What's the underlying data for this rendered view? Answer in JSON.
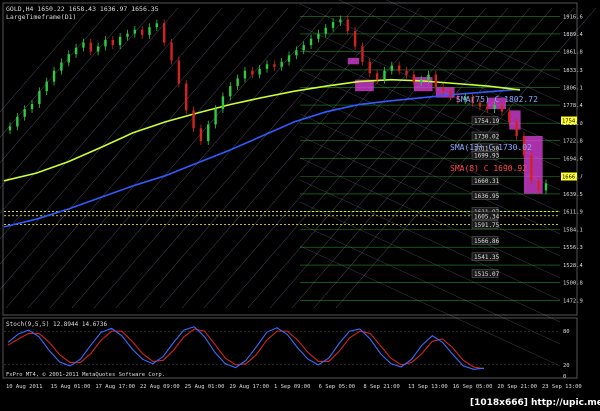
{
  "header": {
    "symbol_line": "GOLD,H4  1650.22  1658.43  1636.97  1656.35",
    "subtitle": "LargeTimeframe(D1)"
  },
  "footer": {
    "copyright": "FxPro MT4, © 2001-2011 MetaQuotes Software Corp.",
    "watermark": "[1018x666] http://upic.me/"
  },
  "colors": {
    "background": "#000000",
    "bull": "#2ecc40",
    "bear": "#d22222",
    "sma_yellow": "#ccff33",
    "sma_blue": "#2f5bff",
    "box_magenta": "#e040e0",
    "gann_lines": "#9aa0c8",
    "level_green": "#2ea82e",
    "level_yellow": "#ffff33",
    "label_box_bg": "#1a1a1a"
  },
  "annotations": {
    "sma75": "SMA(75) C 1802.72",
    "sma13": "SMA(13) C 1730.02",
    "sma_red": "SMA(8) C 1690.92"
  },
  "level_labels": [
    "1754.19",
    "1730.02",
    "1711.50",
    "1699.93",
    "1660.31",
    "1636.95",
    "1611.97",
    "1605.34",
    "1591.75",
    "1566.86",
    "1541.35",
    "1515.07"
  ],
  "oscillator": {
    "label": "Stoch(9,5,5) 12.8944 14.6736",
    "ticks": [
      "80",
      "20",
      "0"
    ]
  },
  "chart_data": {
    "type": "candlestick",
    "title": "GOLD,H4",
    "ylim": [
      1455,
      1930
    ],
    "y_ticks": [
      1916.6,
      1889.4,
      1861.8,
      1833.3,
      1806.1,
      1778.4,
      1750.0,
      1722.8,
      1694.6,
      1666.7,
      1639.5,
      1611.9,
      1584.1,
      1556.3,
      1528.4,
      1500.8,
      1472.9
    ],
    "x_ticks": [
      "10 Aug 2011",
      "15 Aug 01:00",
      "17 Aug 17:00",
      "22 Aug 09:00",
      "25 Aug 01:00",
      "29 Aug 17:00",
      "1 Sep 09:00",
      "6 Sep 05:00",
      "8 Sep 21:00",
      "13 Sep 13:00",
      "16 Sep 05:00",
      "20 Sep 21:00",
      "23 Sep 13:00"
    ],
    "last_price": 1656.35,
    "price_markers": [
      1754.19,
      1666.7
    ],
    "sma_yellow": [
      1660,
      1672,
      1690,
      1712,
      1735,
      1752,
      1766,
      1779,
      1790,
      1800,
      1808,
      1815,
      1818,
      1816,
      1812,
      1808,
      1802
    ],
    "sma_blue": [
      1588,
      1600,
      1616,
      1634,
      1652,
      1668,
      1688,
      1708,
      1730,
      1752,
      1768,
      1779,
      1785,
      1790,
      1795,
      1799,
      1803
    ],
    "candles_close": [
      1745,
      1760,
      1772,
      1780,
      1800,
      1815,
      1832,
      1845,
      1858,
      1868,
      1876,
      1862,
      1870,
      1880,
      1872,
      1885,
      1890,
      1896,
      1888,
      1900,
      1906,
      1876,
      1848,
      1812,
      1770,
      1742,
      1722,
      1748,
      1772,
      1792,
      1808,
      1820,
      1832,
      1826,
      1835,
      1842,
      1838,
      1846,
      1856,
      1864,
      1872,
      1882,
      1890,
      1899,
      1908,
      1912,
      1894,
      1870,
      1846,
      1828,
      1818,
      1832,
      1840,
      1832,
      1826,
      1814,
      1818,
      1826,
      1806,
      1800,
      1792,
      1786,
      1791,
      1782,
      1776,
      1772,
      1778,
      1768,
      1752,
      1730,
      1700,
      1660,
      1645,
      1656
    ],
    "stoch_k": [
      60,
      75,
      82,
      70,
      45,
      25,
      18,
      30,
      55,
      78,
      85,
      72,
      48,
      30,
      22,
      35,
      60,
      82,
      88,
      70,
      42,
      22,
      15,
      28,
      52,
      78,
      86,
      74,
      50,
      30,
      20,
      32,
      58,
      80,
      84,
      66,
      40,
      22,
      16,
      30,
      55,
      72,
      60,
      38,
      18,
      12,
      14
    ],
    "stoch_d": [
      55,
      66,
      76,
      76,
      60,
      38,
      24,
      24,
      40,
      64,
      80,
      80,
      62,
      40,
      26,
      28,
      46,
      70,
      84,
      80,
      56,
      32,
      20,
      22,
      38,
      64,
      80,
      80,
      64,
      42,
      26,
      26,
      44,
      68,
      80,
      76,
      54,
      32,
      20,
      24,
      40,
      62,
      66,
      50,
      28,
      16,
      13
    ]
  }
}
